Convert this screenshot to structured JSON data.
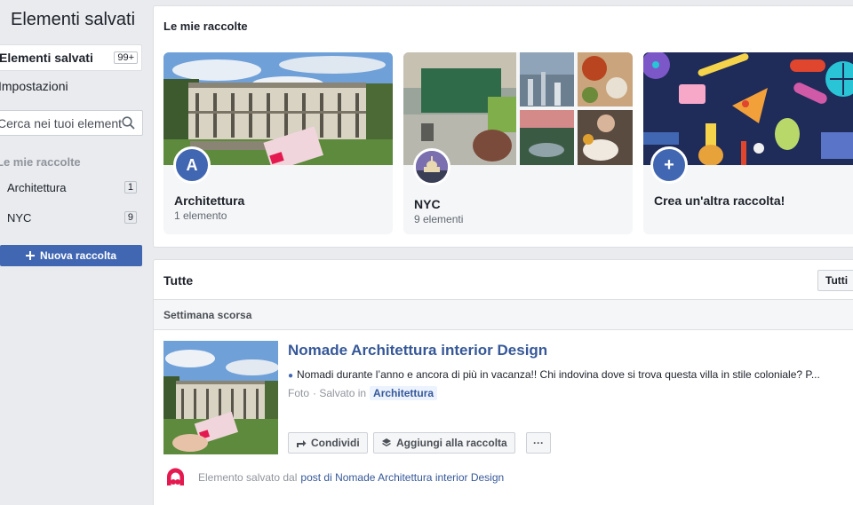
{
  "sidebar": {
    "title": "Elementi salvati",
    "nav": [
      {
        "label": "Elementi salvati",
        "count": "99+",
        "selected": true
      },
      {
        "label": "Impostazioni"
      }
    ],
    "search_placeholder": "Cerca nei tuoi elementi",
    "collections_heading": "Le mie raccolte",
    "collections": [
      {
        "label": "Architettura",
        "count": "1"
      },
      {
        "label": "NYC",
        "count": "9"
      }
    ],
    "new_collection_label": "Nuova raccolta"
  },
  "collections_panel": {
    "heading": "Le mie raccolte",
    "cards": [
      {
        "name": "Architettura",
        "count": "1 elemento",
        "avatar_letter": "A"
      },
      {
        "name": "NYC",
        "count": "9 elementi"
      },
      {
        "name": "Crea un'altra raccolta!",
        "avatar_symbol": "+"
      }
    ]
  },
  "feed": {
    "heading": "Tutte",
    "filter_label": "Tutti",
    "section_label": "Settimana scorsa",
    "items": [
      {
        "title": "Nomade Architettura interior Design",
        "description": "Nomadi durante l’anno e ancora di più in vacanza!! Chi indovina dove si trova questa villa in stile coloniale? P...",
        "type": "Foto",
        "saved_in_prefix": "· Salvato in",
        "collection_tag": "Architettura",
        "share_label": "Condividi",
        "add_label": "Aggiungi alla raccolta",
        "more_label": "···",
        "source_prefix": "Elemento salvato dal",
        "source_link": "post di Nomade Architettura interior Design"
      }
    ]
  },
  "colors": {
    "brand_blue": "#4267b2",
    "link_blue": "#365899",
    "background": "#e9ebee",
    "logo_red": "#e4194f"
  }
}
